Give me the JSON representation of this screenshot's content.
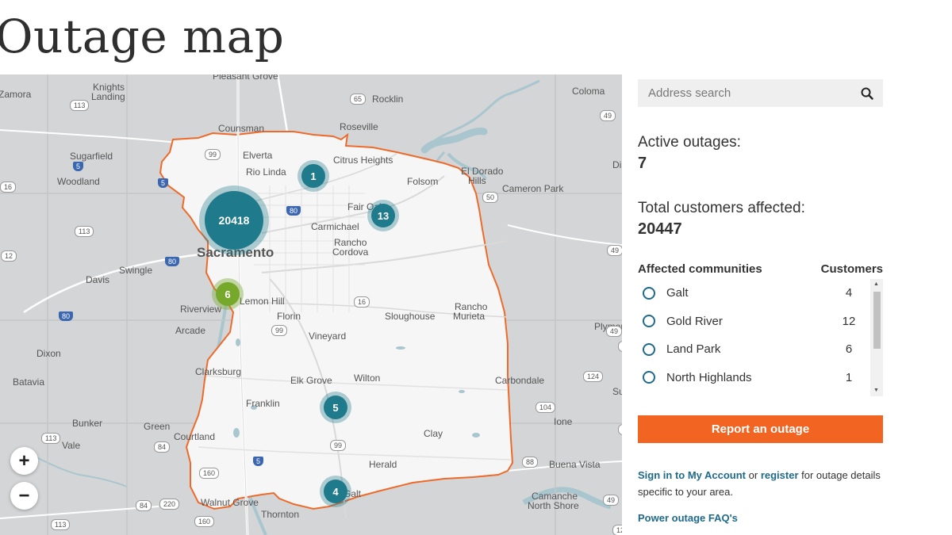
{
  "page": {
    "title": "Outage map"
  },
  "search": {
    "placeholder": "Address search"
  },
  "stats": {
    "active_label": "Active outages:",
    "active_value": "7",
    "customers_label": "Total customers affected:",
    "customers_value": "20447"
  },
  "communities": {
    "header_name": "Affected communities",
    "header_count": "Customers",
    "items": [
      {
        "name": "Galt",
        "count": "4"
      },
      {
        "name": "Gold River",
        "count": "12"
      },
      {
        "name": "Land Park",
        "count": "6"
      },
      {
        "name": "North Highlands",
        "count": "1"
      }
    ]
  },
  "actions": {
    "report_label": "Report an outage",
    "signin_link": "Sign in to My Account",
    "or_text": " or ",
    "register_link": "register",
    "signin_suffix": " for outage details specific to your area.",
    "faq_link": "Power outage FAQ's"
  },
  "map": {
    "zoom_in": "+",
    "zoom_out": "−",
    "colors": {
      "boundary": "#ef6a2a",
      "cluster_teal": "#1f7a8c",
      "cluster_green": "#76a82c",
      "water": "#a9c6cf"
    },
    "clusters": [
      "1",
      "20418",
      "13",
      "6",
      "5",
      "4"
    ],
    "places": [
      "Pleasant Grove",
      "Zamora",
      "Knights",
      "Landing",
      "Rocklin",
      "Coloma",
      "Counsman",
      "Roseville",
      "Sugarfield",
      "Elverta",
      "Citrus Heights",
      "El Dorado",
      "Hills",
      "Woodland",
      "Rio Linda",
      "Folsom",
      "Cameron Park",
      "Fair Oaks",
      "Carmichael",
      "Rancho",
      "Cordova",
      "Sacramento",
      "Davis",
      "Swingle",
      "Lemon Hill",
      "Riverview",
      "Rancho",
      "Murieta",
      "Florin",
      "Sloughouse",
      "Arcade",
      "Vineyard",
      "Plymou",
      "Dixon",
      "Clarksburg",
      "Wilton",
      "Carbondale",
      "Elk Grove",
      "Batavia",
      "Franklin",
      "Ione",
      "Bunker",
      "Green",
      "Clay",
      "Vale",
      "Courtland",
      "Herald",
      "Buena Vista",
      "Walnut Grove",
      "Galt",
      "Camanche",
      "North Shore",
      "Thornton",
      "Dia",
      "Su"
    ],
    "highways": [
      "113",
      "65",
      "49",
      "99",
      "5",
      "80",
      "50",
      "16",
      "49",
      "113",
      "16",
      "80",
      "49",
      "124",
      "80",
      "99",
      "104",
      "113",
      "84",
      "99",
      "88",
      "160",
      "5",
      "88",
      "84",
      "220",
      "160",
      "12",
      "113",
      "88",
      "5",
      "49",
      "12"
    ]
  }
}
